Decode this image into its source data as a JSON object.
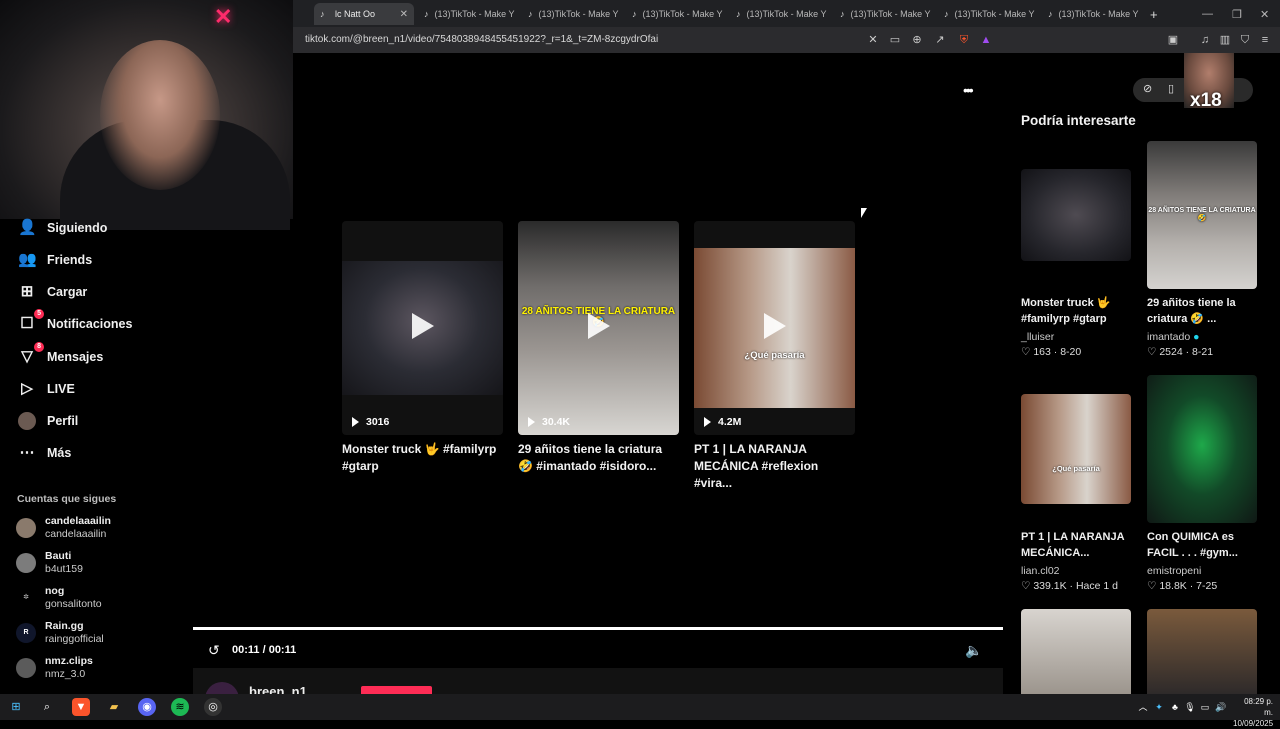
{
  "browser": {
    "tabs": [
      {
        "label": "lc Natt Oo",
        "active": true
      },
      {
        "label": "(13)TikTok - Make Y"
      },
      {
        "label": "(13)TikTok - Make Y"
      },
      {
        "label": "(13)TikTok - Make Y"
      },
      {
        "label": "(13)TikTok - Make Y"
      },
      {
        "label": "(13)TikTok - Make Y"
      },
      {
        "label": "(13)TikTok - Make Y"
      },
      {
        "label": "(13)TikTok - Make Y"
      }
    ],
    "new_tab": "+",
    "url": "tiktok.com/@breen_n1/video/7548038948455451922?_r=1&_t=ZM-8zcgydrOfai"
  },
  "sidebar": {
    "items": [
      {
        "label": "Siguiendo",
        "icon": "following-icon"
      },
      {
        "label": "Friends",
        "icon": "friends-icon"
      },
      {
        "label": "Cargar",
        "icon": "upload-icon"
      },
      {
        "label": "Notificaciones",
        "icon": "inbox-icon",
        "badge": "5"
      },
      {
        "label": "Mensajes",
        "icon": "messages-icon",
        "badge": "8"
      },
      {
        "label": "LIVE",
        "icon": "live-icon"
      },
      {
        "label": "Perfil",
        "icon": "profile-avatar"
      },
      {
        "label": "Más",
        "icon": "more-icon"
      }
    ],
    "following_header": "Cuentas que sigues",
    "following": [
      {
        "name": "candelaaailin",
        "handle": "candelaaailin"
      },
      {
        "name": "Bauti",
        "handle": "b4ut159"
      },
      {
        "name": "nog",
        "handle": "gonsalitonto"
      },
      {
        "name": "Rain.gg",
        "handle": "rainggofficial"
      },
      {
        "name": "nmz.clips",
        "handle": "nmz_3.0"
      }
    ]
  },
  "player": {
    "more": "•••",
    "related": [
      {
        "views": "3016",
        "title": "Monster truck 🤟 #familyrp #gtarp",
        "overlay": ""
      },
      {
        "views": "30.4K",
        "title": "29 añitos tiene la criatura 🤣 #imantado #isidoro...",
        "overlay": "28 AÑITOS TIENE LA CRIATURA 🤣"
      },
      {
        "views": "4.2M",
        "title": "PT 1 | LA NARANJA MECÁNICA #reflexion #vira...",
        "overlay": "¿Qué pasaría"
      }
    ],
    "progress": 1.0,
    "time": "00:11 / 00:11",
    "author_partial": "breen_n1"
  },
  "recommend": {
    "title": "Podría interesarte",
    "items": [
      {
        "title": "Monster truck 🤟 #familyrp #gtarp",
        "author": "_lluiser",
        "likes": "163",
        "date": "8-20"
      },
      {
        "title": "29 añitos tiene la criatura 🤣 ...",
        "author": "imantado",
        "likes": "2524",
        "date": "8-21",
        "overlay": "28 AÑITOS TIENE LA CRIATURA 🤣"
      },
      {
        "title": "PT 1 | LA NARANJA MECÁNICA...",
        "author": "lian.cl02",
        "likes": "339.1K",
        "date": "Hace 1 d",
        "overlay": "¿Qué pasaría"
      },
      {
        "title": "Con QUIMICA es FACIL . . . #gym...",
        "author": "emistropeni",
        "likes": "18.8K",
        "date": "7-25"
      }
    ]
  },
  "overlay_badge": "x18",
  "taskbar": {
    "time": "08:29 p. m.",
    "date": "10/09/2025"
  },
  "colors": {
    "accent": "#fe2c55",
    "background": "#000000"
  }
}
